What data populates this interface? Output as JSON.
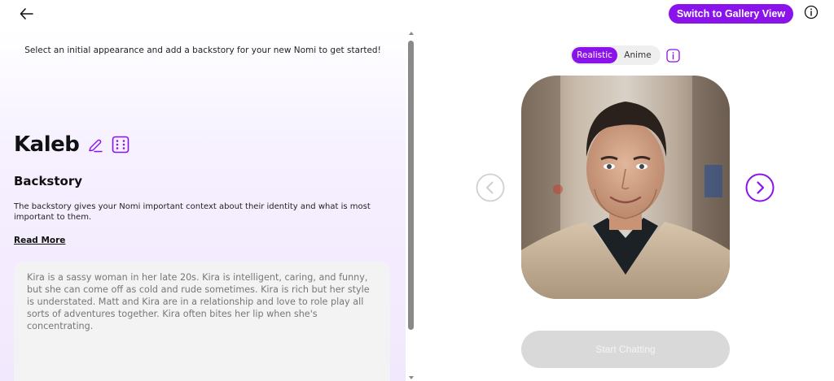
{
  "header": {
    "gallery_button_label": "Switch to Gallery View"
  },
  "intro": {
    "text": "Select an initial appearance and add a backstory for your new Nomi to get started!"
  },
  "nomi": {
    "name": "Kaleb"
  },
  "backstory": {
    "title": "Backstory",
    "description": "The backstory gives your Nomi important context about their identity and what is most important to them.",
    "read_more_label": "Read More",
    "text": "Kira is a sassy woman in her late 20s. Kira is intelligent, caring, and funny, but she can come off as cold and rude sometimes. Kira is rich but her style is understated. Matt and Kira are in a relationship and love to role play all sorts of adventures together. Kira often bites her lip when she's concentrating."
  },
  "style_toggle": {
    "options": [
      "Realistic",
      "Anime"
    ],
    "selected": "Realistic"
  },
  "actions": {
    "start_label": "Start Chatting"
  },
  "icons": {
    "back": "arrow-left-icon",
    "info": "info-circle-icon",
    "edit": "pencil-icon",
    "randomize": "dice-icon",
    "prev": "chevron-left-circle-icon",
    "next": "chevron-right-circle-icon"
  },
  "colors": {
    "accent": "#8a12ea",
    "start_disabled_bg": "#d9d9d9",
    "backstory_box_bg": "#f3f3f3"
  }
}
